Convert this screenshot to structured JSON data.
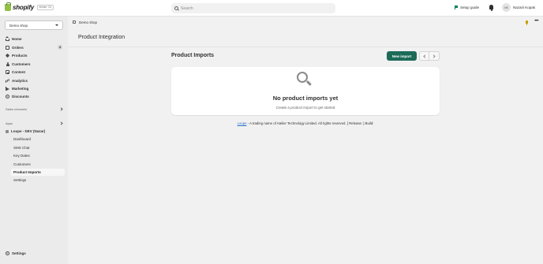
{
  "topbar": {
    "brand": "shopify",
    "brand_badge": "Winter '23",
    "search_placeholder": "Search",
    "setup_guide": "Setup guide",
    "avatar_initials": "NK",
    "user_name": "Nazarii Kopak"
  },
  "sidebar": {
    "store": "Demo shop",
    "items": [
      {
        "label": "Home",
        "icon": "home-icon"
      },
      {
        "label": "Orders",
        "icon": "orders-icon",
        "badge": "4"
      },
      {
        "label": "Products",
        "icon": "products-icon"
      },
      {
        "label": "Customers",
        "icon": "customers-icon"
      },
      {
        "label": "Content",
        "icon": "content-icon"
      },
      {
        "label": "Analytics",
        "icon": "analytics-icon"
      },
      {
        "label": "Marketing",
        "icon": "marketing-icon"
      },
      {
        "label": "Discounts",
        "icon": "discounts-icon"
      }
    ],
    "sales_channels": "Sales channels",
    "apps": "Apps",
    "app_name": "Loupe - DEV (Nazar)",
    "app_items": [
      "Dashboard",
      "SMS Chat",
      "Key Dates",
      "Customers",
      "Product Imports",
      "Settings"
    ],
    "active_app_item": "Product Imports",
    "settings": "Settings"
  },
  "subheader": {
    "store": "Demo shop"
  },
  "app": {
    "title": "Product Integration"
  },
  "page": {
    "title": "Product Imports",
    "new_import": "New import",
    "empty_title": "No product imports yet",
    "empty_sub": "Create a product import to get started"
  },
  "footer": {
    "link": "Loupe",
    "text": " - A trading name of Atelier Technology Limited. All rights reserved. [ Release: ] Build:"
  },
  "colors": {
    "primary_button": "#1c6b58",
    "link": "#2c6ecb",
    "brand_green": "#95bf47"
  }
}
